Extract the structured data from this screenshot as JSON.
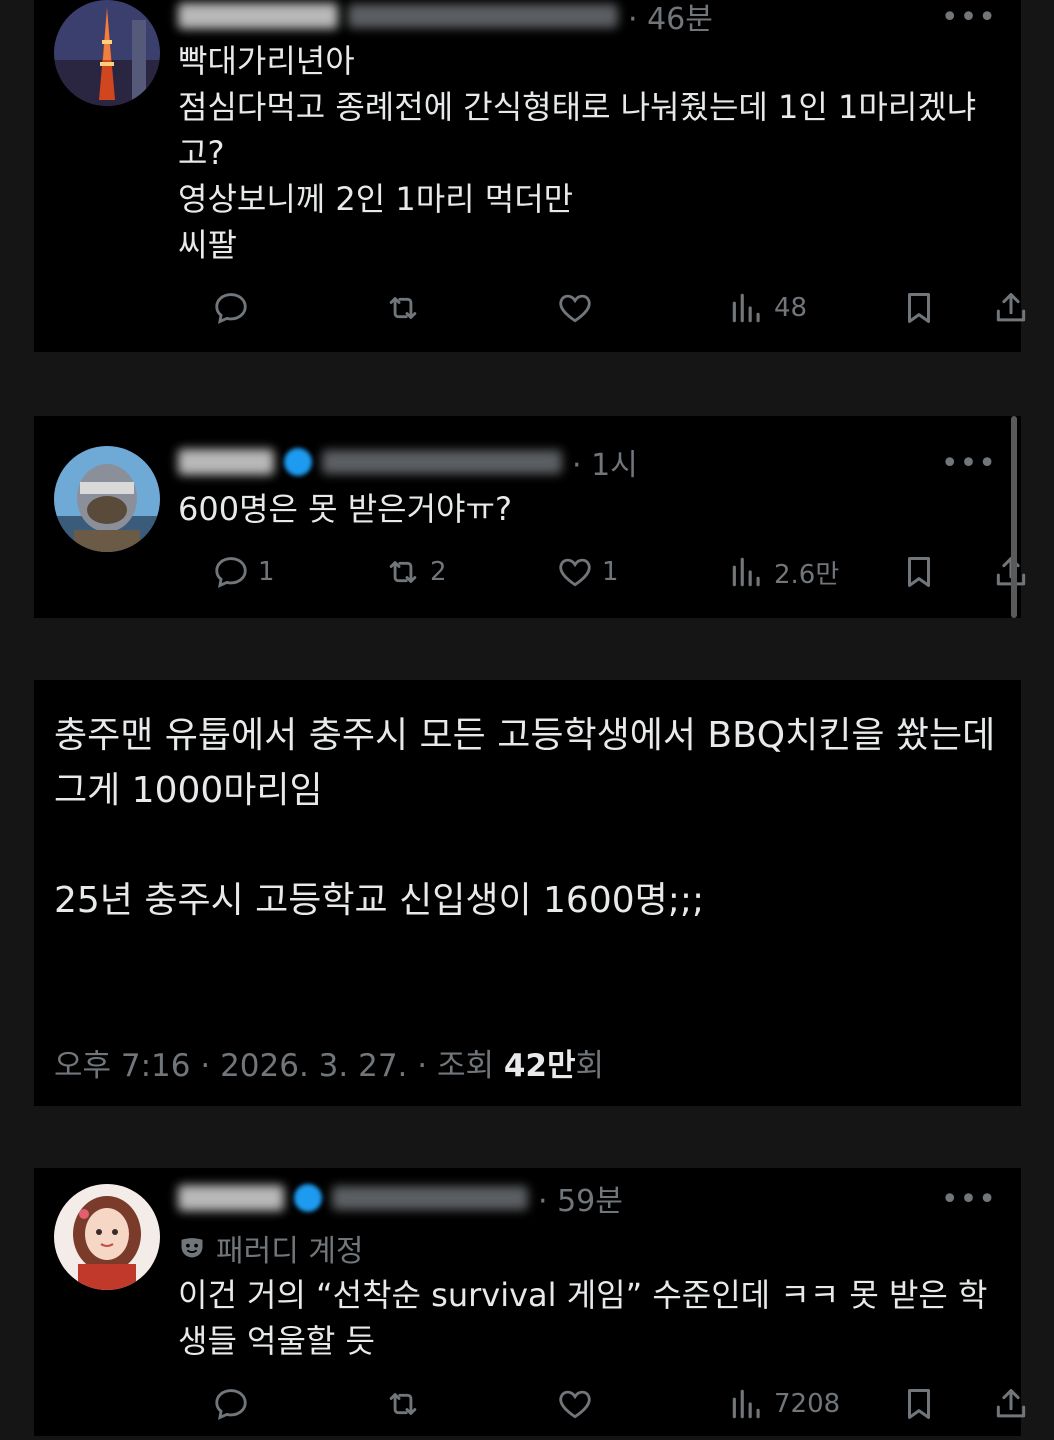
{
  "reply1": {
    "time": "46분",
    "text": "빡대가리년아\n점심다먹고 종례전에 간식형태로 나눠줬는데 1인 1마리겠냐고?\n영상보니께 2인 1마리 먹더만\n씨팔",
    "views": "48"
  },
  "reply2": {
    "time": "1시",
    "text": "600명은 못 받은거야ㅠ?",
    "replies": "1",
    "reposts": "2",
    "likes": "1",
    "views": "2.6만"
  },
  "main_post": {
    "text": "충주맨 유툽에서 충주시 모든 고등학생에서 BBQ치킨을 쐈는데\n그게 1000마리임\n\n25년 충주시 고등학교 신입생이 1600명;;;",
    "timestamp": "오후 7:16 · 2026. 3. 27. · 조회 ",
    "views_count": "42만",
    "views_suffix": "회"
  },
  "reply3": {
    "time": "59분",
    "badge": "패러디 계정",
    "text": "이건 거의 “선착순 survival 게임” 수준인데 ㅋㅋ 못 받은 학생들 억울할 듯",
    "views": "7208"
  },
  "icons": {
    "reply": "reply-icon",
    "repost": "repost-icon",
    "like": "like-icon",
    "views": "views-icon",
    "bookmark": "bookmark-icon",
    "share": "share-icon",
    "more": "more-icon",
    "verified": "verified-icon",
    "parody": "parody-mask-icon"
  },
  "colors": {
    "background": "#151515",
    "card": "#000000",
    "text": "#e7e9ea",
    "muted": "#71767b",
    "verified": "#1d9bf0"
  }
}
